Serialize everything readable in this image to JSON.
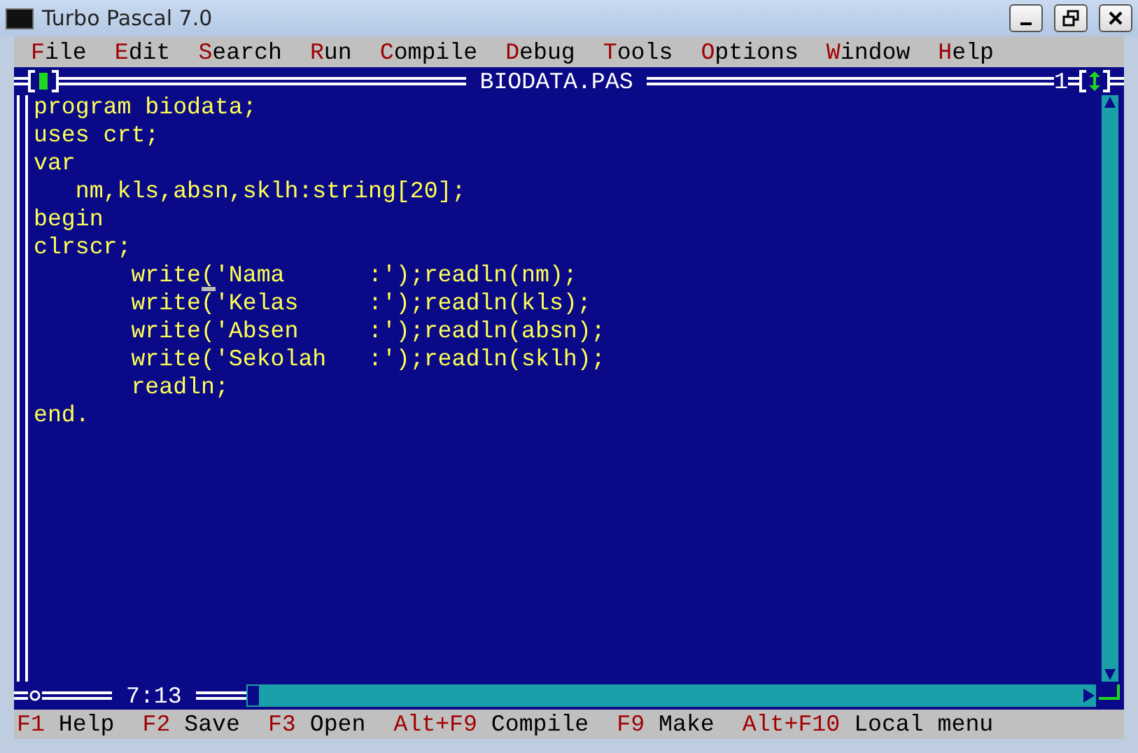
{
  "window": {
    "title": "Turbo Pascal 7.0"
  },
  "menu": [
    {
      "hotkey": "F",
      "rest": "ile"
    },
    {
      "hotkey": "E",
      "rest": "dit"
    },
    {
      "hotkey": "S",
      "rest": "earch"
    },
    {
      "hotkey": "R",
      "rest": "un"
    },
    {
      "hotkey": "C",
      "rest": "ompile"
    },
    {
      "hotkey": "D",
      "rest": "ebug"
    },
    {
      "hotkey": "T",
      "rest": "ools"
    },
    {
      "hotkey": "O",
      "rest": "ptions"
    },
    {
      "hotkey": "W",
      "rest": "indow"
    },
    {
      "hotkey": "H",
      "rest": "elp"
    }
  ],
  "editor": {
    "title": "BIODATA.PAS",
    "window_number": "1",
    "cursor_position": "7:13",
    "lines": [
      "program biodata;",
      "uses crt;",
      "var",
      "   nm,kls,absn,sklh:string[20];",
      "begin",
      "clrscr;",
      "       write('Nama      :');readln(nm);",
      "       write('Kelas     :');readln(kls);",
      "       write('Absen     :');readln(absn);",
      "       write('Sekolah   :');readln(sklh);",
      "       readln;",
      "end."
    ]
  },
  "status_bar": [
    {
      "key": "F1",
      "label": "Help"
    },
    {
      "key": "F2",
      "label": "Save"
    },
    {
      "key": "F3",
      "label": "Open"
    },
    {
      "key": "Alt+F9",
      "label": "Compile"
    },
    {
      "key": "F9",
      "label": "Make"
    },
    {
      "key": "Alt+F10",
      "label": "Local menu"
    }
  ]
}
